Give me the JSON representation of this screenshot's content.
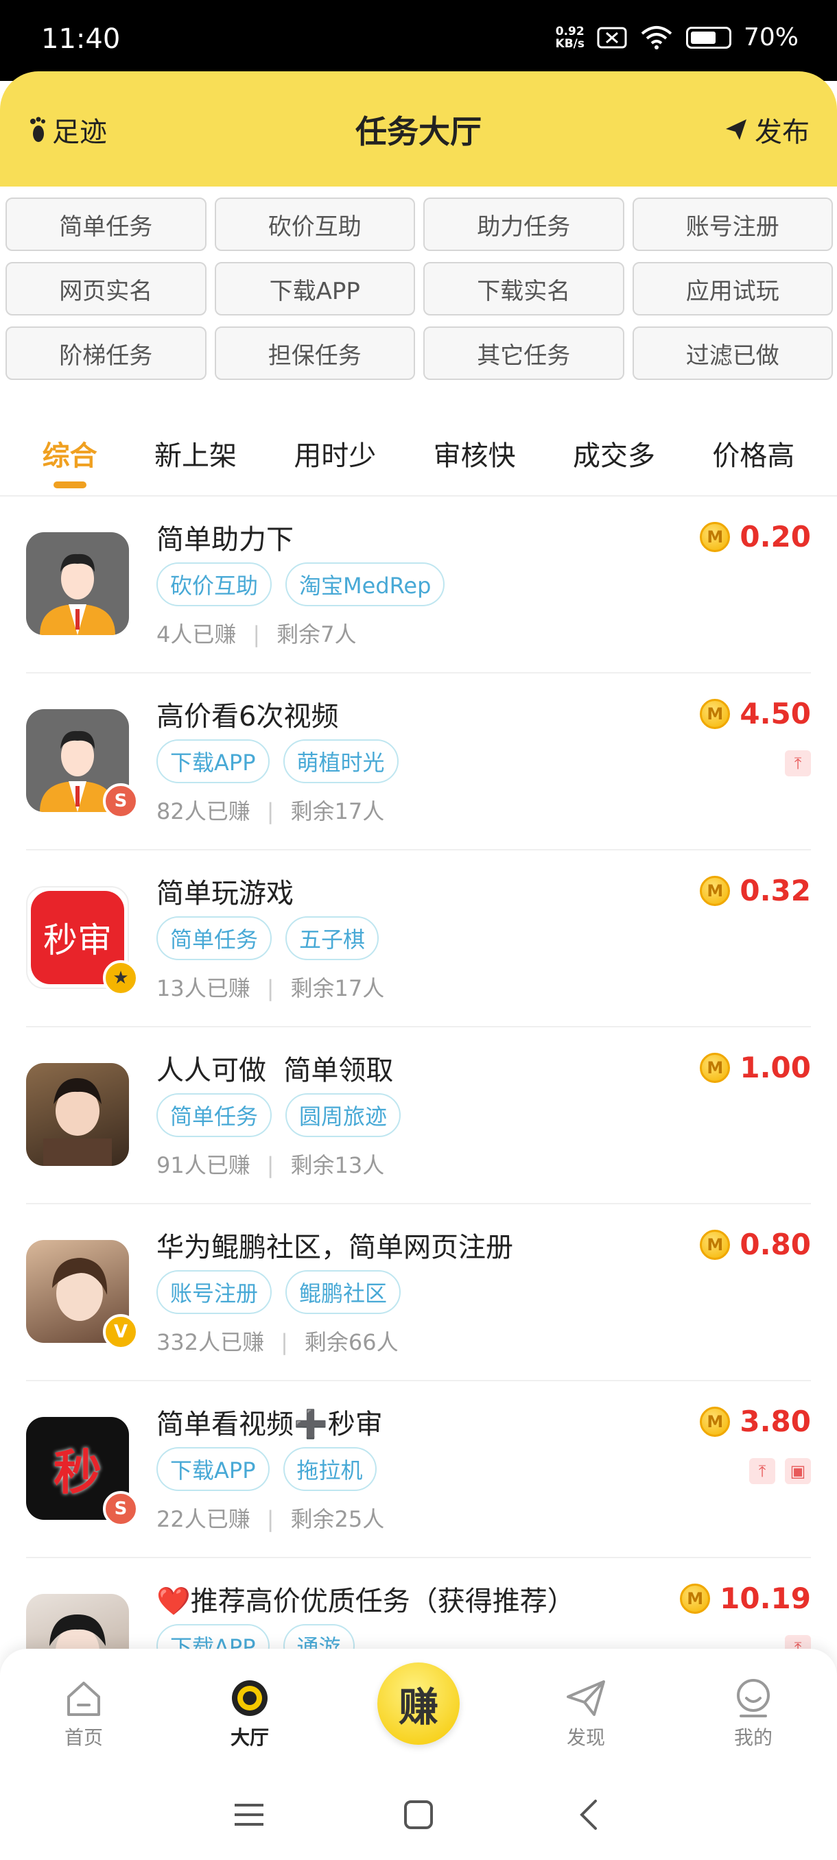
{
  "status_bar": {
    "time": "11:40",
    "net_speed_value": "0.92",
    "net_speed_unit": "KB/s",
    "battery": "70%"
  },
  "header": {
    "left_label": "足迹",
    "title": "任务大厅",
    "right_label": "发布"
  },
  "categories": [
    "简单任务",
    "砍价互助",
    "助力任务",
    "账号注册",
    "网页实名",
    "下载APP",
    "下载实名",
    "应用试玩",
    "阶梯任务",
    "担保任务",
    "其它任务",
    "过滤已做"
  ],
  "sort_tabs": {
    "items": [
      "综合",
      "新上架",
      "用时少",
      "审核快",
      "成交多",
      "价格高"
    ],
    "active": "综合"
  },
  "tasks": [
    {
      "title": "简单助力下",
      "tags": [
        "砍价互助",
        "淘宝MedRep"
      ],
      "earned": "4人已赚",
      "remaining": "剩余7人",
      "price": "0.20",
      "coin": "M",
      "avatar": "person-icon",
      "badge": "",
      "icons": []
    },
    {
      "title": "高价看6次视频",
      "tags": [
        "下载APP",
        "萌植时光"
      ],
      "earned": "82人已赚",
      "remaining": "剩余17人",
      "price": "4.50",
      "coin": "M",
      "avatar": "person-icon",
      "badge": "S",
      "icons": [
        "pin-top-icon"
      ]
    },
    {
      "title": "简单玩游戏",
      "tags": [
        "简单任务",
        "五子棋"
      ],
      "earned": "13人已赚",
      "remaining": "剩余17人",
      "price": "0.32",
      "coin": "M",
      "avatar": "秒审",
      "badge": "★",
      "icons": []
    },
    {
      "title": "人人可做  简单领取",
      "tags": [
        "简单任务",
        "圆周旅迹"
      ],
      "earned": "91人已赚",
      "remaining": "剩余13人",
      "price": "1.00",
      "coin": "M",
      "avatar": "photo",
      "badge": "",
      "icons": []
    },
    {
      "title": "华为鲲鹏社区，简单网页注册",
      "tags": [
        "账号注册",
        "鲲鹏社区"
      ],
      "earned": "332人已赚",
      "remaining": "剩余66人",
      "price": "0.80",
      "coin": "M",
      "avatar": "photo",
      "badge": "V",
      "icons": []
    },
    {
      "title": "简单看视频➕秒审",
      "tags": [
        "下载APP",
        "拖拉机"
      ],
      "earned": "22人已赚",
      "remaining": "剩余25人",
      "price": "3.80",
      "coin": "M",
      "avatar": "秒",
      "badge": "S",
      "icons": [
        "pin-top-icon",
        "guarantee-icon"
      ]
    },
    {
      "title": "❤️推荐高价优质任务（获得推荐）",
      "tags": [
        "下载APP",
        "通游"
      ],
      "earned": "",
      "remaining": "",
      "price": "10.19",
      "coin": "M",
      "avatar": "photo",
      "badge": "",
      "icons": [
        "pin-top-icon"
      ]
    }
  ],
  "bottom_nav": {
    "items": [
      "首页",
      "大厅",
      "赚",
      "发现",
      "我的"
    ],
    "active": "大厅"
  },
  "colors": {
    "header_bg": "#f8de57",
    "accent": "#f0a020",
    "price": "#e8302a",
    "tag": "#48a9d6"
  }
}
